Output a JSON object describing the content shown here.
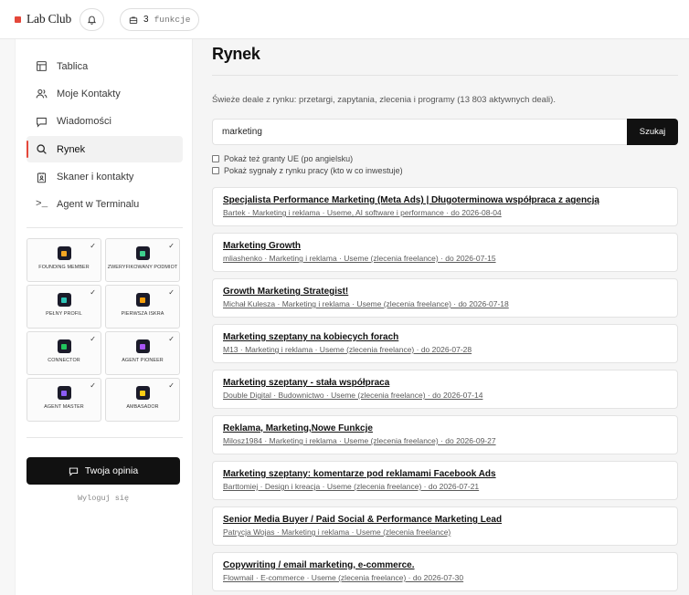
{
  "app": {
    "brand": "Lab Club",
    "features_count": "3",
    "features_word": "funkcje",
    "accent_color": "#e4473a"
  },
  "sidebar": {
    "items": [
      {
        "label": "Tablica",
        "icon": "dashboard-icon",
        "active": false
      },
      {
        "label": "Moje Kontakty",
        "icon": "users-icon",
        "active": false
      },
      {
        "label": "Wiadomości",
        "icon": "message-icon",
        "active": false
      },
      {
        "label": "Rynek",
        "icon": "search-icon",
        "active": true
      },
      {
        "label": "Skaner i kontakty",
        "icon": "scanner-icon",
        "active": false
      },
      {
        "label": "Agent w Terminalu",
        "icon": "terminal-icon",
        "active": false
      }
    ],
    "badges": [
      {
        "label": "FOUNDING MEMBER",
        "color": "#f5a623"
      },
      {
        "label": "ZWERYFIKOWANY PODMIOT",
        "color": "#3ecf8e"
      },
      {
        "label": "PEŁNY PROFIL",
        "color": "#2ec4b6"
      },
      {
        "label": "PIERWSZA ISKRA",
        "color": "#f59e0b"
      },
      {
        "label": "CONNECTOR",
        "color": "#22c55e"
      },
      {
        "label": "AGENT PIONEER",
        "color": "#a855f7"
      },
      {
        "label": "AGENT MASTER",
        "color": "#8b5cf6"
      },
      {
        "label": "AMBASADOR",
        "color": "#facc15"
      }
    ],
    "feedback_label": "Twoja opinia",
    "logout_label": "Wyloguj się"
  },
  "main": {
    "title": "Rynek",
    "subtitle": "Świeże deale z rynku: przetargi, zapytania, zlecenia i programy (13 803 aktywnych deali).",
    "search_value": "marketing",
    "search_button": "Szukaj",
    "options": [
      {
        "label": "Pokaż też granty UE (po angielsku)",
        "checked": false
      },
      {
        "label": "Pokaż sygnały z rynku pracy (kto w co inwestuje)",
        "checked": false
      }
    ],
    "listings": [
      {
        "title": "Specjalista Performance Marketing (Meta Ads) | Długoterminowa współpraca z agencją",
        "meta": "Bartek · Marketing i reklama · Useme, AI software i performance · do 2026-08-04"
      },
      {
        "title": "Marketing Growth",
        "meta": "mliashenko · Marketing i reklama · Useme (zlecenia freelance) · do 2026-07-15"
      },
      {
        "title": "Growth Marketing Strategist!",
        "meta": "Michał Kulesza · Marketing i reklama · Useme (zlecenia freelance) · do 2026-07-18"
      },
      {
        "title": "Marketing szeptany na kobiecych forach",
        "meta": "M13 · Marketing i reklama · Useme (zlecenia freelance) · do 2026-07-28"
      },
      {
        "title": "Marketing szeptany - stała współpraca",
        "meta": "Double Digital · Budownictwo · Useme (zlecenia freelance) · do 2026-07-14"
      },
      {
        "title": "Reklama, Marketing,Nowe Funkcje",
        "meta": "Milosz1984 · Marketing i reklama · Useme (zlecenia freelance) · do 2026-09-27"
      },
      {
        "title": "Marketing szeptany: komentarze pod reklamami Facebook Ads",
        "meta": "Barttomiej · Design i kreacja · Useme (zlecenia freelance) · do 2026-07-21"
      },
      {
        "title": "Senior Media Buyer / Paid Social & Performance Marketing Lead",
        "meta": "Patrycja Wojas · Marketing i reklama · Useme (zlecenia freelance)"
      },
      {
        "title": "Copywriting / email marketing, e-commerce.",
        "meta": "Flowmail · E-commerce · Useme (zlecenia freelance) · do 2026-07-30"
      }
    ]
  }
}
